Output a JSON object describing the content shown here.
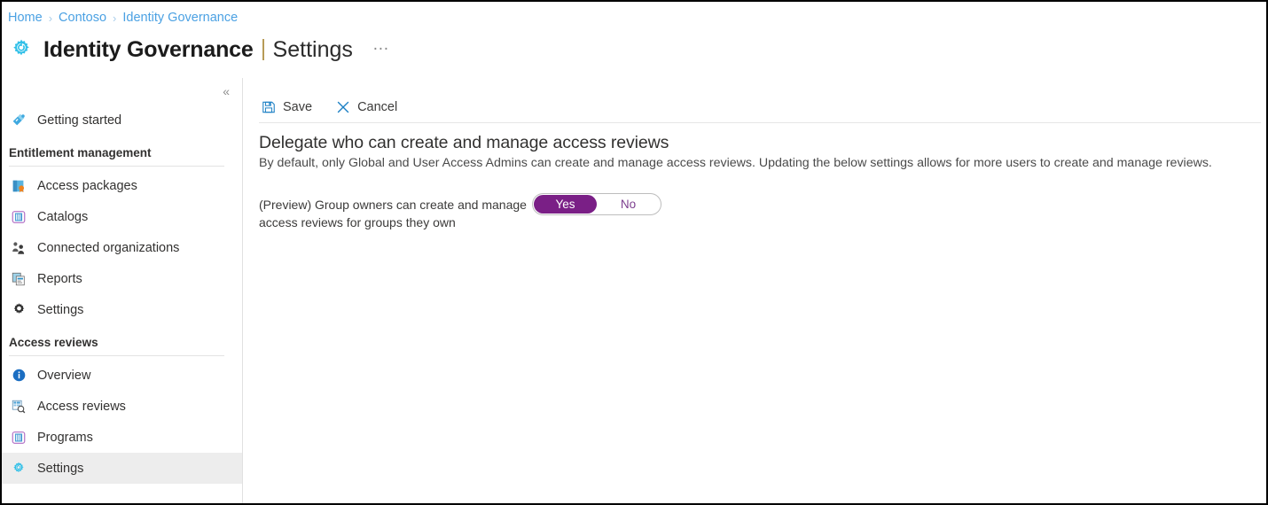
{
  "breadcrumb": {
    "items": [
      "Home",
      "Contoso",
      "Identity Governance"
    ],
    "separator": "›"
  },
  "header": {
    "icon": "identity-governance-gear-icon",
    "title": "Identity Governance",
    "divider": "|",
    "subtitle": "Settings",
    "more_menu": "…"
  },
  "sidebar": {
    "collapse_label": "«",
    "top_items": [
      {
        "label": "Getting started",
        "icon": "rocket-icon",
        "selected": false
      }
    ],
    "sections": [
      {
        "title": "Entitlement management",
        "items": [
          {
            "label": "Access packages",
            "icon": "access-package-icon",
            "selected": false
          },
          {
            "label": "Catalogs",
            "icon": "catalog-book-icon",
            "selected": false
          },
          {
            "label": "Connected organizations",
            "icon": "people-icon",
            "selected": false
          },
          {
            "label": "Reports",
            "icon": "reports-icon",
            "selected": false
          },
          {
            "label": "Settings",
            "icon": "gear-icon",
            "selected": false
          }
        ]
      },
      {
        "title": "Access reviews",
        "items": [
          {
            "label": "Overview",
            "icon": "info-icon",
            "selected": false
          },
          {
            "label": "Access reviews",
            "icon": "access-review-search-icon",
            "selected": false
          },
          {
            "label": "Programs",
            "icon": "programs-book-icon",
            "selected": false
          },
          {
            "label": "Settings",
            "icon": "gear-blue-icon",
            "selected": true
          }
        ]
      }
    ]
  },
  "command_bar": {
    "save": {
      "label": "Save",
      "icon": "save-disk-icon"
    },
    "cancel": {
      "label": "Cancel",
      "icon": "close-x-icon"
    }
  },
  "main": {
    "heading": "Delegate who can create and manage access reviews",
    "description": "By default, only Global and User Access Admins can create and manage access reviews. Updating the below settings allows for more users to create and manage reviews.",
    "setting": {
      "label_line1": "(Preview) Group owners can create and manage",
      "label_line2": "access reviews for groups they own",
      "toggle": {
        "options": [
          "Yes",
          "No"
        ],
        "selected": "Yes"
      }
    }
  },
  "colors": {
    "breadcrumb_link": "#4ba1e3",
    "accent_cyan": "#32c0e8",
    "toggle_active_bg": "#7a1f86",
    "toggle_text": "#7d3f8f",
    "selected_nav_bg": "#ededed",
    "title_divider": "#b79b57"
  }
}
